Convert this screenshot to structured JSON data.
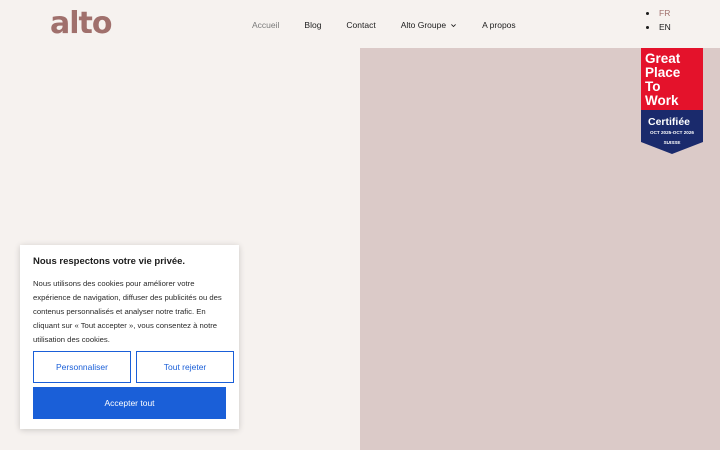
{
  "header": {
    "logo": "alto",
    "nav": [
      {
        "label": "Accueil",
        "active": true
      },
      {
        "label": "Blog"
      },
      {
        "label": "Contact"
      },
      {
        "label": "Alto Groupe",
        "has_dropdown": true
      },
      {
        "label": "A propos"
      }
    ],
    "languages": [
      {
        "label": "FR",
        "active": true
      },
      {
        "label": "EN"
      }
    ]
  },
  "badge": {
    "line1": "Great",
    "line2": "Place",
    "line3": "To",
    "line4": "Work",
    "certified": "Certifiée",
    "period": "OCT 2025-OCT 2026",
    "country": "SUISSE"
  },
  "cookie": {
    "title": "Nous respectons votre vie privée.",
    "text": "Nous utilisons des cookies pour améliorer votre expérience de navigation, diffuser des publicités ou des contenus personnalisés et analyser notre trafic. En cliquant sur « Tout accepter », vous consentez à notre utilisation des cookies.",
    "customize_label": "Personnaliser",
    "reject_label": "Tout rejeter",
    "accept_label": "Accepter tout"
  },
  "colors": {
    "background": "#f6f2ef",
    "brand": "#a0706c",
    "panel": "#dbcac8",
    "primary": "#1a5fd8",
    "badge_red": "#e4122b",
    "badge_navy": "#1a2a6c"
  }
}
